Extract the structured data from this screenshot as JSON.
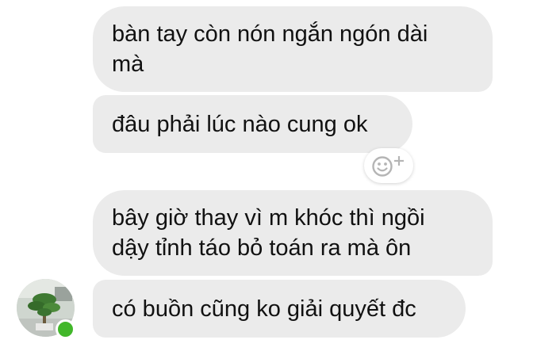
{
  "messages": [
    {
      "text_line1": "bàn tay còn nón ngắn ngón dài",
      "text_line2": "mà"
    },
    {
      "text_line1": "đâu phải lúc nào cung ok"
    },
    {
      "text_line1": "bây giờ thay vì m khóc thì ngồi",
      "text_line2": "dậy tỉnh táo bỏ toán ra mà ôn"
    },
    {
      "text_line1": "có buồn cũng ko giải quyết đc"
    }
  ],
  "reaction_button": {
    "icon": "smiley-plus-icon"
  },
  "sender": {
    "avatar": "avatar",
    "status": "online",
    "status_color": "#42b72a"
  },
  "colors": {
    "bubble": "#ebebeb",
    "text": "#111111",
    "background": "#ffffff"
  }
}
